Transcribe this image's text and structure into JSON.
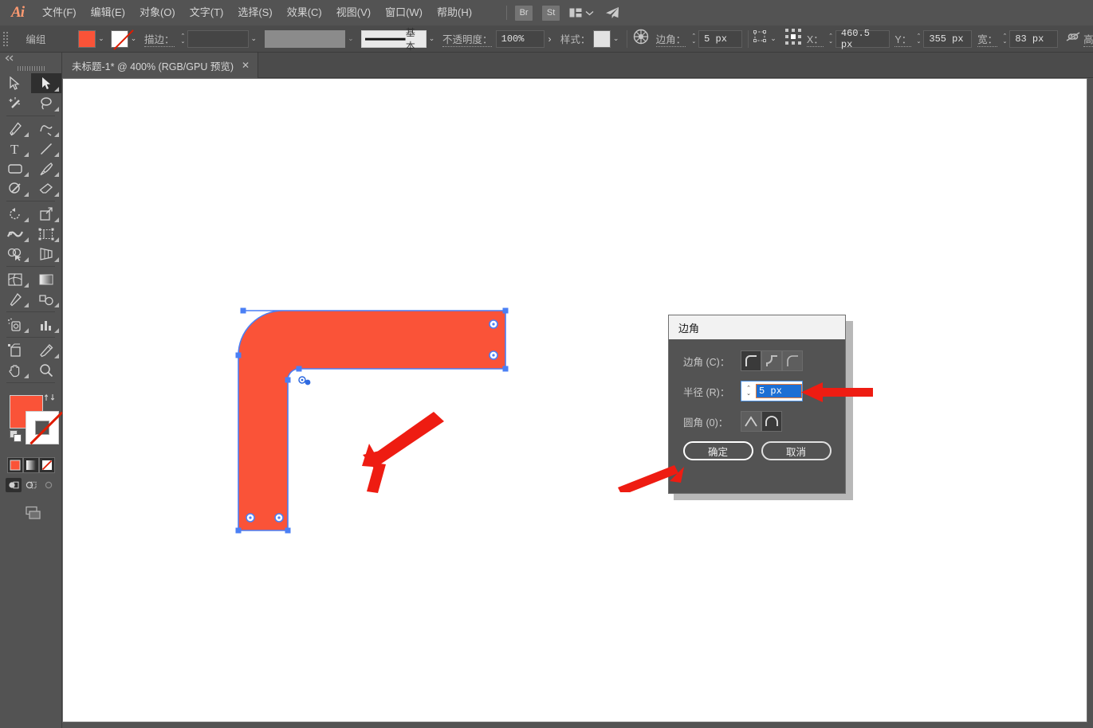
{
  "app": {
    "name": "Ai",
    "logo_color": "#ff9a71",
    "accent_orange": "#fa5338",
    "selection_blue": "#4a7ff5"
  },
  "menubar": {
    "items": [
      {
        "label": "文件(F)",
        "name": "menu-file"
      },
      {
        "label": "编辑(E)",
        "name": "menu-edit"
      },
      {
        "label": "对象(O)",
        "name": "menu-object"
      },
      {
        "label": "文字(T)",
        "name": "menu-type"
      },
      {
        "label": "选择(S)",
        "name": "menu-select"
      },
      {
        "label": "效果(C)",
        "name": "menu-effect"
      },
      {
        "label": "视图(V)",
        "name": "menu-view"
      },
      {
        "label": "窗口(W)",
        "name": "menu-window"
      },
      {
        "label": "帮助(H)",
        "name": "menu-help"
      }
    ],
    "bridge_badge": "Br",
    "stock_badge": "St",
    "arrange_icon": "arrange-documents-icon",
    "chevron_icon": "chevron-down-icon",
    "share_icon": "paper-plane-icon"
  },
  "optionsbar": {
    "selection_label": "编组",
    "fill_swatch": "#fa5338",
    "stroke_swatch_none": "none",
    "stroke_label": "描边：",
    "stroke_weight_value": "",
    "stroke_profile_value": "",
    "brush_label": "基本",
    "opacity_label": "不透明度：",
    "opacity_value": "100%",
    "opacity_arrow": "›",
    "style_label": "样式：",
    "recolor_icon": "recolor-artwork-icon",
    "corner_label": "边角：",
    "corner_value": "5 px",
    "transform_icon": "transform-bounds-icon",
    "reference_point_icon": "reference-point-grid-icon",
    "x_label": "X：",
    "x_value": "460.5 px",
    "y_label": "Y：",
    "y_value": "355 px",
    "w_label": "宽：",
    "w_value": "83 px",
    "link_icon": "broken-link-icon",
    "h_label": "高"
  },
  "tabbar": {
    "document_title": "未标题-1* @ 400% (RGB/GPU 预览)",
    "close_label": "✕"
  },
  "toolbar": {
    "panel_label": "",
    "tools": [
      {
        "name": "tool-selection",
        "label": "选择工具",
        "active": false
      },
      {
        "name": "tool-direct-selection",
        "label": "直接选择工具",
        "active": true
      },
      {
        "name": "tool-magic-wand",
        "label": "魔棒工具",
        "active": false
      },
      {
        "name": "tool-lasso",
        "label": "套索工具",
        "active": false
      },
      {
        "name": "tool-pen",
        "label": "钢笔工具",
        "active": false
      },
      {
        "name": "tool-curvature",
        "label": "曲率工具",
        "active": false
      },
      {
        "name": "tool-type",
        "label": "文字工具",
        "active": false
      },
      {
        "name": "tool-line-segment",
        "label": "直线段工具",
        "active": false
      },
      {
        "name": "tool-rectangle",
        "label": "矩形工具",
        "active": false
      },
      {
        "name": "tool-paintbrush",
        "label": "画笔工具",
        "active": false
      },
      {
        "name": "tool-shaper",
        "label": "Shaper 工具",
        "active": false
      },
      {
        "name": "tool-eraser",
        "label": "橡皮擦工具",
        "active": false
      },
      {
        "name": "tool-rotate",
        "label": "旋转工具",
        "active": false
      },
      {
        "name": "tool-scale",
        "label": "比例缩放工具",
        "active": false
      },
      {
        "name": "tool-width",
        "label": "宽度工具",
        "active": false
      },
      {
        "name": "tool-free-transform",
        "label": "自由变换工具",
        "active": false
      },
      {
        "name": "tool-shape-builder",
        "label": "形状生成器工具",
        "active": false
      },
      {
        "name": "tool-perspective-grid",
        "label": "透视网格工具",
        "active": false
      },
      {
        "name": "tool-mesh",
        "label": "网格工具",
        "active": false
      },
      {
        "name": "tool-gradient",
        "label": "渐变工具",
        "active": false
      },
      {
        "name": "tool-eyedropper",
        "label": "吸管工具",
        "active": false
      },
      {
        "name": "tool-blend",
        "label": "混合工具",
        "active": false
      },
      {
        "name": "tool-symbol-sprayer",
        "label": "符号喷枪工具",
        "active": false
      },
      {
        "name": "tool-column-graph",
        "label": "柱形图工具",
        "active": false
      },
      {
        "name": "tool-artboard",
        "label": "画板工具",
        "active": false
      },
      {
        "name": "tool-slice",
        "label": "切片工具",
        "active": false
      },
      {
        "name": "tool-hand",
        "label": "抓手工具",
        "active": false
      },
      {
        "name": "tool-zoom",
        "label": "缩放工具",
        "active": false
      }
    ],
    "fill_color": "#fa5338",
    "stroke_color": "none",
    "swap_icon": "swap-fill-stroke-icon",
    "default_icon": "default-fill-stroke-icon",
    "color_modes": [
      {
        "name": "mode-color",
        "label": "颜色"
      },
      {
        "name": "mode-gradient",
        "label": "渐变"
      },
      {
        "name": "mode-none",
        "label": "无"
      }
    ],
    "draw_modes": [
      {
        "name": "draw-normal",
        "label": "正常绘图",
        "selected": true
      },
      {
        "name": "draw-behind",
        "label": "背面绘图",
        "selected": false
      },
      {
        "name": "draw-inside",
        "label": "内部绘图",
        "selected": false
      }
    ],
    "screen_mode_icon": "change-screen-mode-icon"
  },
  "artwork": {
    "shape_name": "l-shaped-path",
    "fill": "#fa5338",
    "anchor_color": "#4a7ff5",
    "corner_widget_label": "实时转角构件",
    "selected": true
  },
  "dialog": {
    "title": "边角",
    "corner_row_label": "边角 (C)：",
    "corner_options": [
      {
        "name": "corner-round",
        "label": "圆角",
        "selected": true
      },
      {
        "name": "corner-inverted-round",
        "label": "反向圆角",
        "selected": false
      },
      {
        "name": "corner-chamfer",
        "label": "斜角",
        "selected": false
      }
    ],
    "radius_row_label": "半径 (R)：",
    "radius_value": "5 px",
    "round_row_label": "圆角 (0)：",
    "round_options": [
      {
        "name": "round-absolute",
        "label": "绝对",
        "selected": false
      },
      {
        "name": "round-relative",
        "label": "相对",
        "selected": true
      }
    ],
    "ok_label": "确定",
    "cancel_label": "取消"
  },
  "annotations": {
    "arrow_color": "#ee1c12",
    "arrows": [
      {
        "name": "arrow-to-corner-widget-diagonal"
      },
      {
        "name": "arrow-to-corner-widget-vertical"
      },
      {
        "name": "arrow-to-radius-field"
      },
      {
        "name": "arrow-to-ok-button"
      }
    ]
  }
}
